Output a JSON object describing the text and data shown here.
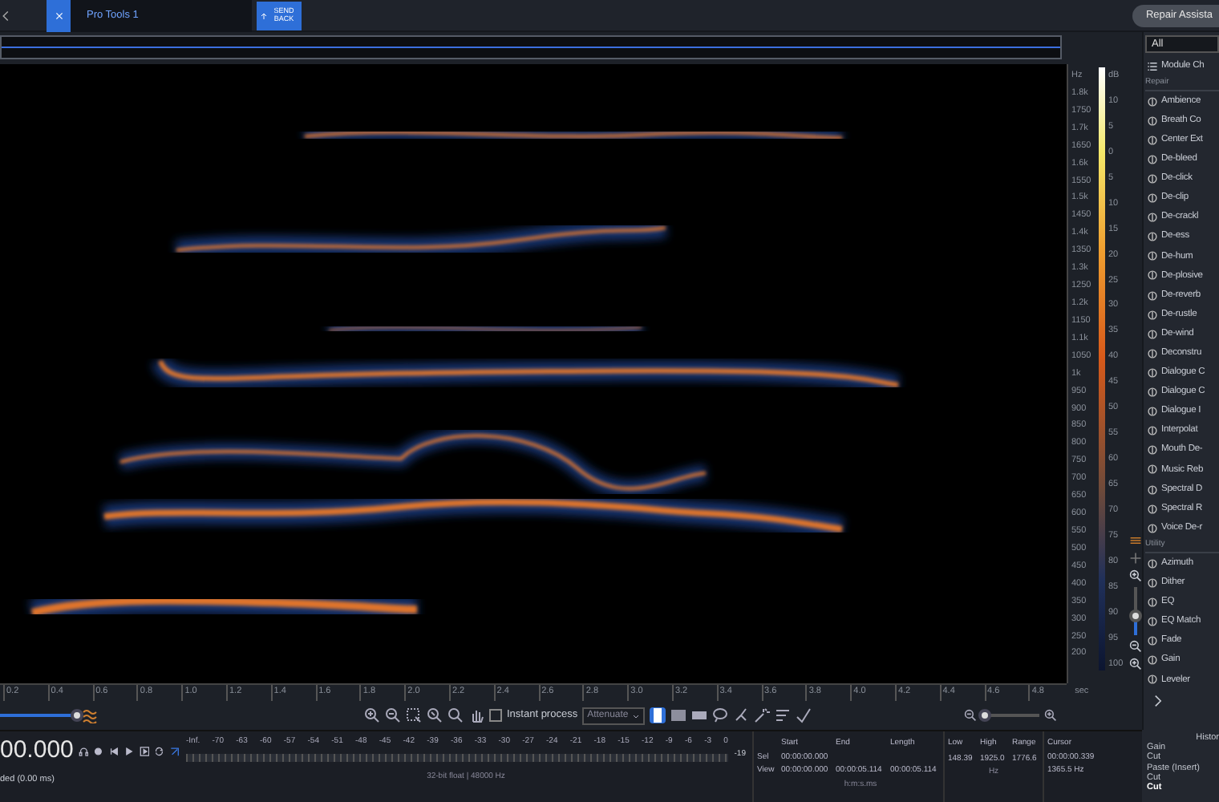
{
  "top_bar": {
    "tabs": [
      {
        "label": "Pro Tools 1",
        "selected": true
      }
    ],
    "send_back": "SEND BACK",
    "repair_assistant": "Repair Assista"
  },
  "spectrogram": {
    "frequency_axis": {
      "unit": "Hz",
      "labels": [
        "1.8k",
        "1750",
        "1.7k",
        "1650",
        "1.6k",
        "1550",
        "1.5k",
        "1450",
        "1.4k",
        "1350",
        "1.3k",
        "1250",
        "1.2k",
        "1150",
        "1.1k",
        "1050",
        "1k",
        "950",
        "900",
        "850",
        "800",
        "750",
        "700",
        "650",
        "600",
        "550",
        "500",
        "450",
        "400",
        "350",
        "300",
        "250",
        "200"
      ]
    },
    "db_scale": {
      "unit": "dB",
      "labels": [
        "10",
        "5",
        "0",
        "5",
        "10",
        "15",
        "20",
        "25",
        "30",
        "35",
        "40",
        "45",
        "50",
        "55",
        "60",
        "65",
        "70",
        "75",
        "80",
        "85",
        "90",
        "95",
        "100"
      ]
    },
    "time_axis": {
      "labels": [
        "0.2",
        "0.4",
        "0.6",
        "0.8",
        "1.0",
        "1.2",
        "1.4",
        "1.6",
        "1.8",
        "2.0",
        "2.2",
        "2.4",
        "2.6",
        "2.8",
        "3.0",
        "3.2",
        "3.4",
        "3.6",
        "3.8",
        "4.0",
        "4.2",
        "4.4",
        "4.6",
        "4.8"
      ],
      "unit": "sec"
    }
  },
  "view_controls": {
    "vertical_zoom": {
      "level": 0.4
    },
    "playback_zoom": {
      "level": 1
    },
    "horizontal_zoom": {
      "level": 0.05
    }
  },
  "toolbar": {
    "instant_process": {
      "label": "Instant process",
      "checked": false
    },
    "mode": "Attenuate",
    "selection_tools": [
      {
        "kind": "time",
        "selected": true
      },
      {
        "kind": "rectangle",
        "selected": false
      },
      {
        "kind": "frequency",
        "selected": false
      },
      {
        "kind": "lasso",
        "selected": false
      },
      {
        "kind": "brush",
        "selected": false
      },
      {
        "kind": "wand",
        "selected": false
      },
      {
        "kind": "harmonic",
        "selected": false
      }
    ]
  },
  "transport": {
    "time": "00.000",
    "status": "ded (0.00 ms)"
  },
  "meter": {
    "labels": [
      "-Inf.",
      "-70",
      "-63",
      "-60",
      "-57",
      "-54",
      "-51",
      "-48",
      "-45",
      "-42",
      "-39",
      "-36",
      "-33",
      "-30",
      "-27",
      "-24",
      "-21",
      "-18",
      "-15",
      "-12",
      "-9",
      "-6",
      "-3",
      "0"
    ],
    "peak": "-19",
    "format": "32-bit float | 48000 Hz"
  },
  "selection_info": {
    "columns": [
      "Start",
      "End",
      "Length"
    ],
    "rows": [
      {
        "label": "Sel",
        "start": "00:00:00.000",
        "end": "",
        "length": ""
      },
      {
        "label": "View",
        "start": "00:00:00.000",
        "end": "00:00:05.114",
        "length": "00:00:05.114"
      }
    ],
    "unit": "h:m:s.ms"
  },
  "frequency_info": {
    "columns": [
      "Low",
      "High",
      "Range"
    ],
    "values": [
      "148.39",
      "1925.0",
      "1776.6"
    ],
    "unit": "Hz"
  },
  "cursor_info": {
    "title": "Cursor",
    "time": "00:00:00.339",
    "frequency": "1365.5 Hz"
  },
  "module_panel": {
    "filter": "All",
    "module_chain": "Module Ch",
    "sections": [
      {
        "title": "Repair",
        "modules": [
          "Ambience",
          "Breath Co",
          "Center Ext",
          "De-bleed",
          "De-click",
          "De-clip",
          "De-crackl",
          "De-ess",
          "De-hum",
          "De-plosive",
          "De-reverb",
          "De-rustle",
          "De-wind",
          "Deconstru",
          "Dialogue C",
          "Dialogue C",
          "Dialogue I",
          "Interpolat",
          "Mouth De-",
          "Music Reb",
          "Spectral D",
          "Spectral R",
          "Voice De-r"
        ]
      },
      {
        "title": "Utility",
        "modules": [
          "Azimuth",
          "Dither",
          "EQ",
          "EQ Match",
          "Fade",
          "Gain",
          "Leveler"
        ]
      }
    ]
  },
  "history": {
    "title": "Histor",
    "items": [
      {
        "label": "Gain",
        "selected": false
      },
      {
        "label": "Cut",
        "selected": false
      },
      {
        "label": "Paste (Insert)",
        "selected": false
      },
      {
        "label": "Cut",
        "selected": false
      },
      {
        "label": "Cut",
        "selected": true
      }
    ]
  }
}
